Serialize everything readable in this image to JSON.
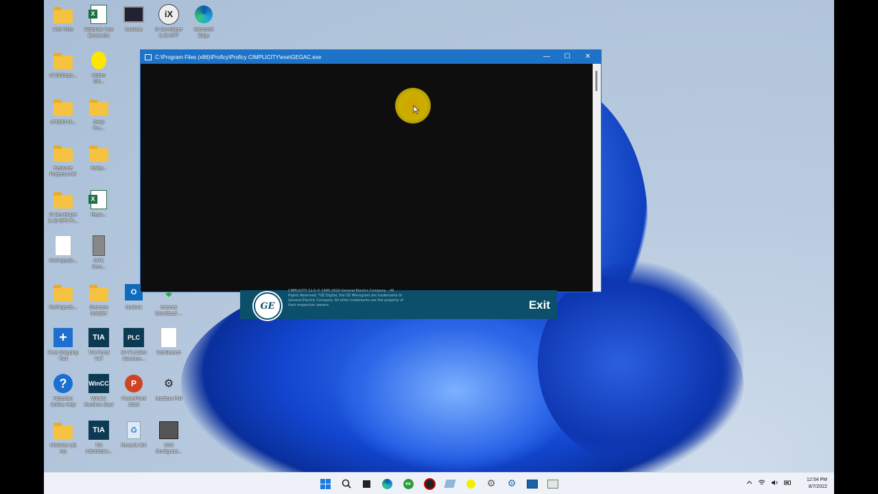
{
  "desktop_icons": [
    {
      "label": "HMI Files",
      "icon": "folder-icon"
    },
    {
      "label": "Historian Test\nExcel.xlsx",
      "icon": "excel-icon"
    },
    {
      "label": "IranMac",
      "icon": "computer-icon"
    },
    {
      "label": "iX Developer\n2.40 SP7",
      "icon": "ix-developer-icon"
    },
    {
      "label": "Microsoft\nEdge",
      "icon": "edge-icon"
    },
    {
      "label": "s71500opc...",
      "icon": "folder-icon"
    },
    {
      "label": "Kolom\nShi...",
      "icon": "shortcut-icon"
    },
    {
      "label": "s71500 Ul...",
      "icon": "folder-icon"
    },
    {
      "label": "Cimp\nPro...",
      "icon": "folder-icon"
    },
    {
      "label": "Kepware\nProjects-IAK",
      "icon": "folder-icon"
    },
    {
      "label": "Kalay...",
      "icon": "folder-icon"
    },
    {
      "label": "iX Developer\n2.40 SP6 Pr...",
      "icon": "folder-icon"
    },
    {
      "label": "Repo...",
      "icon": "excel-icon"
    },
    {
      "label": "FixProjectb...",
      "icon": "document-icon"
    },
    {
      "label": "OPC\nServ...",
      "icon": "server-icon"
    },
    {
      "label": "FixProjectb...",
      "icon": "folder-icon"
    },
    {
      "label": "Siemens\nInstaller",
      "icon": "folder-icon"
    },
    {
      "label": "Outlook",
      "icon": "outlook-icon"
    },
    {
      "label": "Internet\nDownload ...",
      "icon": "download-icon"
    },
    {
      "label": "Free Snipping\nTool",
      "icon": "snipping-icon"
    },
    {
      "label": "TIA Portal\nV17",
      "icon": "tia-icon"
    },
    {
      "label": "S7-PLCSIM\nAdvance...",
      "icon": "plcsim-icon"
    },
    {
      "label": "Workbench",
      "icon": "document-icon"
    },
    {
      "label": "Historian\nOnline Help",
      "icon": "help-icon"
    },
    {
      "label": "WinCC\nRuntime Start",
      "icon": "wincc-icon"
    },
    {
      "label": "PowerPoint\n2016",
      "icon": "powerpoint-icon"
    },
    {
      "label": "Modbus Poll",
      "icon": "modbus-icon"
    },
    {
      "label": "Historian (4)\nmp",
      "icon": "folder-icon"
    },
    {
      "label": "TIA\nAdministra...",
      "icon": "tia-admin-icon"
    },
    {
      "label": "Recycle Bin",
      "icon": "recycle-bin-icon"
    },
    {
      "label": "I/O3\nConfigurat...",
      "icon": "config-icon"
    }
  ],
  "console": {
    "title": "C:\\Program Files (x86)\\Proficy\\Proficy CIMPLICITY\\exe\\GEGAC.exe",
    "minimize": "—",
    "maximize": "☐",
    "close": "✕"
  },
  "splash": {
    "logo": "GE",
    "copyright": "CIMPLICITY 11.0 © 1995-2020 General Electric Company – All Rights Reserved. *GE Digital, the GE Monogram are trademarks of General Electric Company. All other trademarks are the property of their respective owners.",
    "exit_label": "Exit"
  },
  "taskbar": {
    "icons": [
      "windows-start-icon",
      "search-icon",
      "task-view-icon",
      "edge-icon",
      "excel-icon",
      "record-icon",
      "paint-icon",
      "pointer-highlight-icon",
      "settings-icon",
      "control-panel-icon",
      "remote-icon",
      "console-icon"
    ],
    "time": "12:54 PM",
    "date": "8/7/2022"
  },
  "colors": {
    "titlebar": "#1c73c7",
    "splash": "#0b4f6a",
    "taskbar": "#eef2f8"
  }
}
